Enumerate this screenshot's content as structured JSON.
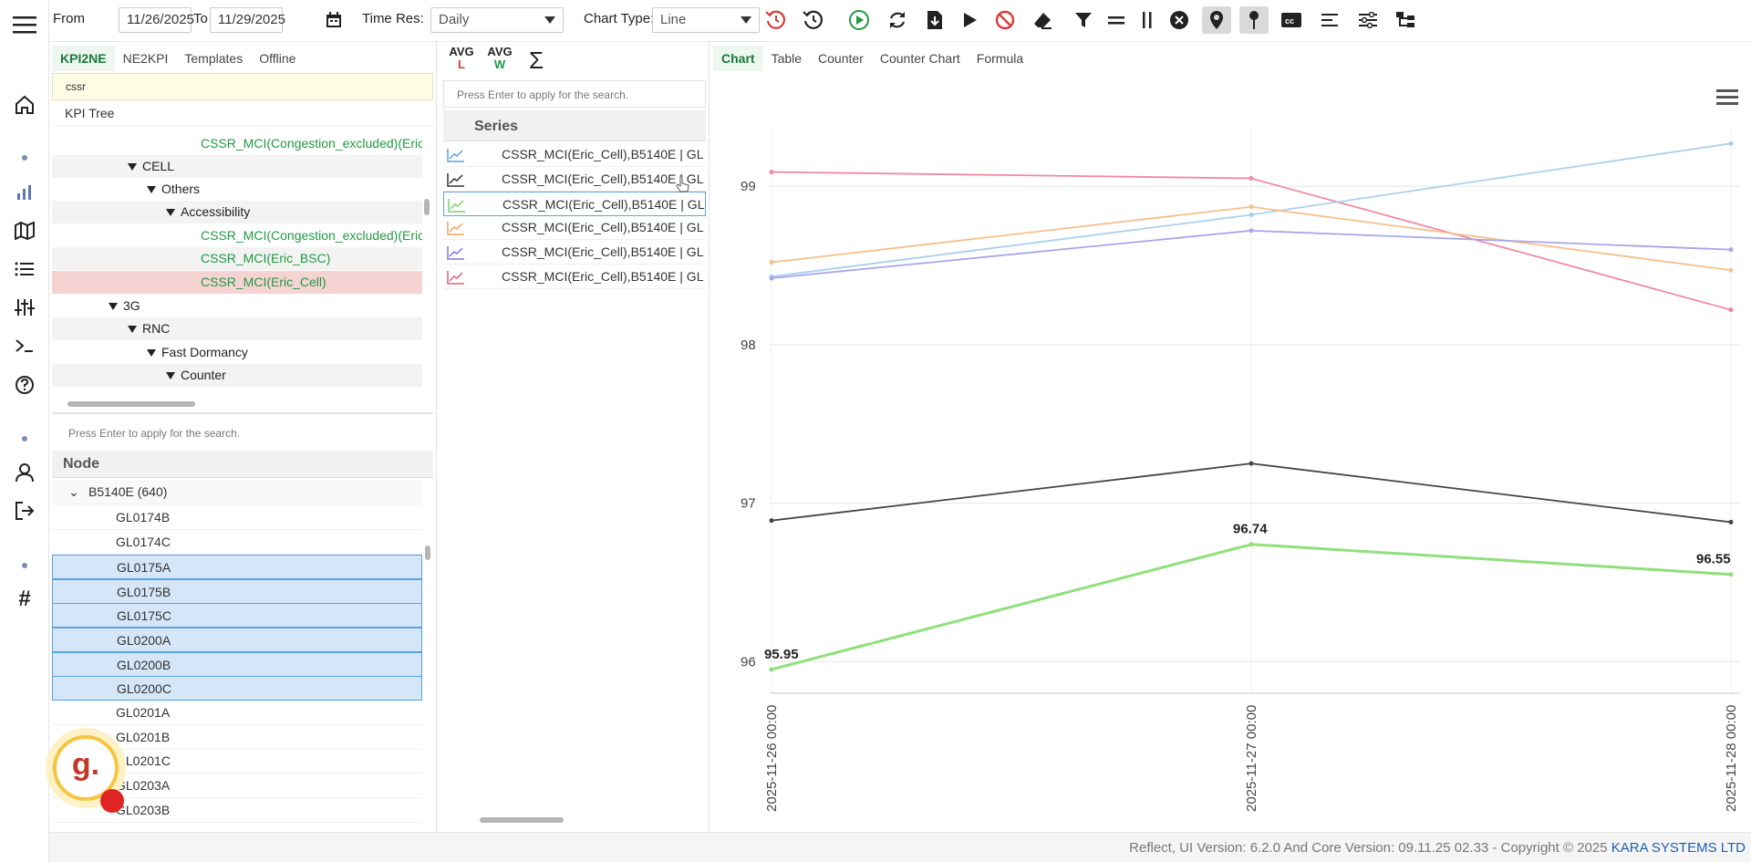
{
  "toolbar": {
    "from_label": "From",
    "from_value": "11/26/2025",
    "to_label": "To",
    "to_value": "11/29/2025",
    "timeres_label": "Time Res:",
    "timeres_value": "Daily",
    "charttype_label": "Chart Type:",
    "charttype_value": "Line"
  },
  "kpi_panel": {
    "tabs": [
      "KPI2NE",
      "NE2KPI",
      "Templates",
      "Offline"
    ],
    "search_value": "cssr",
    "tree_header": "KPI Tree",
    "tree_rows": [
      {
        "label": "CSSR_MCI(Congestion_excluded)(Eric",
        "kind": "leaf"
      },
      {
        "label": "CELL",
        "kind": "node"
      },
      {
        "label": "Others",
        "kind": "node"
      },
      {
        "label": "Accessibility",
        "kind": "node"
      },
      {
        "label": "CSSR_MCI(Congestion_excluded)(Eric",
        "kind": "leaf"
      },
      {
        "label": "CSSR_MCI(Eric_BSC)",
        "kind": "leaf"
      },
      {
        "label": "CSSR_MCI(Eric_Cell)",
        "kind": "leaf-selected"
      },
      {
        "label": "3G",
        "kind": "node"
      },
      {
        "label": "RNC",
        "kind": "node"
      },
      {
        "label": "Fast Dormancy",
        "kind": "node"
      },
      {
        "label": "Counter",
        "kind": "node"
      }
    ]
  },
  "node_panel": {
    "search_placeholder": "Press Enter to apply for the search.",
    "header": "Node",
    "group_label": "B5140E (640)",
    "rows": [
      "GL0174B",
      "GL0174C",
      "GL0175A",
      "GL0175B",
      "GL0175C",
      "GL0200A",
      "GL0200B",
      "GL0200C",
      "GL0201A",
      "GL0201B",
      "GL0201C",
      "GL0203A",
      "GL0203B"
    ],
    "selected_rows": [
      "GL0175A",
      "GL0175B",
      "GL0175C",
      "GL0200A",
      "GL0200B",
      "GL0200C"
    ]
  },
  "series_panel": {
    "avg_l_top": "AVG",
    "avg_l_bottom": "L",
    "avg_w_top": "AVG",
    "avg_w_bottom": "W",
    "sum_symbol": "Σ",
    "search_placeholder": "Press Enter to apply for the search.",
    "header": "Series",
    "rows": [
      {
        "label": "CSSR_MCI(Eric_Cell),B5140E | GL",
        "color": "#5aa2dd"
      },
      {
        "label": "CSSR_MCI(Eric_Cell),B5140E | GL",
        "color": "#333333"
      },
      {
        "label": "CSSR_MCI(Eric_Cell),B5140E | GL",
        "color": "#7ad36b"
      },
      {
        "label": "CSSR_MCI(Eric_Cell),B5140E | GL",
        "color": "#f0a25a"
      },
      {
        "label": "CSSR_MCI(Eric_Cell),B5140E | GL",
        "color": "#7c7ce0"
      },
      {
        "label": "CSSR_MCI(Eric_Cell),B5140E | GL",
        "color": "#e0607a"
      }
    ]
  },
  "chart_tabs": [
    "Chart",
    "Table",
    "Counter",
    "Counter Chart",
    "Formula"
  ],
  "chart_data": {
    "type": "line",
    "x": [
      "2025-11-26 00:00",
      "2025-11-27 00:00",
      "2025-11-28 00:00"
    ],
    "ylim": [
      95.8,
      99.6
    ],
    "yticks": [
      96,
      97,
      98,
      99
    ],
    "series": [
      {
        "color": "#f08aa0",
        "values": [
          99.09,
          99.05,
          98.22
        ]
      },
      {
        "color": "#a9d0ee",
        "values": [
          98.43,
          98.82,
          99.27
        ]
      },
      {
        "color": "#f5c08a",
        "values": [
          98.52,
          98.87,
          98.47
        ]
      },
      {
        "color": "#a9a6e8",
        "values": [
          98.42,
          98.72,
          98.6
        ]
      },
      {
        "color": "#444444",
        "values": [
          96.89,
          97.25,
          96.88
        ]
      },
      {
        "color": "#8fe07a",
        "values": [
          95.95,
          96.74,
          96.55
        ],
        "labels": [
          "95.95",
          "96.74",
          "96.55"
        ]
      }
    ]
  },
  "footer": {
    "text": "Reflect, UI Version: 6.2.0 And Core Version: 09.11.25 02.33 - Copyright © 2025 ",
    "brand": "KARA SYSTEMS LTD"
  },
  "badge_letter": "g."
}
